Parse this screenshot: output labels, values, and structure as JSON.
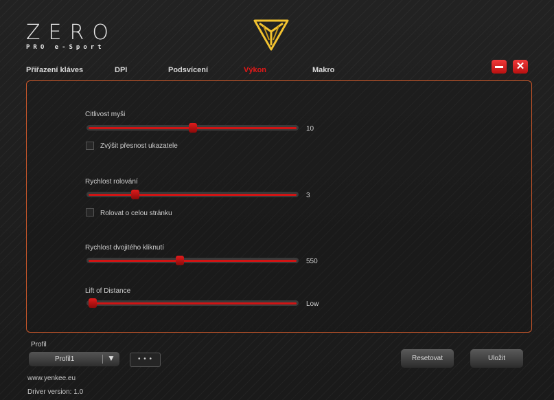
{
  "brand": {
    "name": "ZERO",
    "subtitle": "PRO e-Sport",
    "emblem_icon": "yellow-triangle-emblem"
  },
  "tabs": [
    {
      "label": "Přiřazení kláves"
    },
    {
      "label": "DPI"
    },
    {
      "label": "Podsvícení"
    },
    {
      "label": "Výkon",
      "active": true
    },
    {
      "label": "Makro"
    }
  ],
  "window": {
    "minimize_icon": "minimize-icon",
    "close_glyph": "✕"
  },
  "colors": {
    "accent": "#e01818",
    "panel_border": "#c8572a",
    "emblem": "#f2c230"
  },
  "settings": {
    "sensitivity": {
      "label": "Citlivost myši",
      "value": "10",
      "position": 0.5
    },
    "precision": {
      "label": "Zvýšit přesnost ukazatele",
      "checked": false
    },
    "scroll_speed": {
      "label": "Rychlost rolování",
      "value": "3",
      "position": 0.23
    },
    "page_scroll": {
      "label": "Rolovat o celou stránku",
      "checked": false
    },
    "double_click": {
      "label": "Rychlost dvojitého kliknutí",
      "value": "550",
      "position": 0.44
    },
    "lift_off": {
      "label": "Lift of Distance",
      "value": "Low",
      "position": 0.03
    }
  },
  "profile": {
    "label": "Profil",
    "selected": "Profil1",
    "arrow": "▼",
    "more_label": "• • •"
  },
  "buttons": {
    "reset": "Resetovat",
    "save": "Uložit"
  },
  "footer": {
    "url": "www.yenkee.eu",
    "driver": "Driver version:  1.0"
  }
}
